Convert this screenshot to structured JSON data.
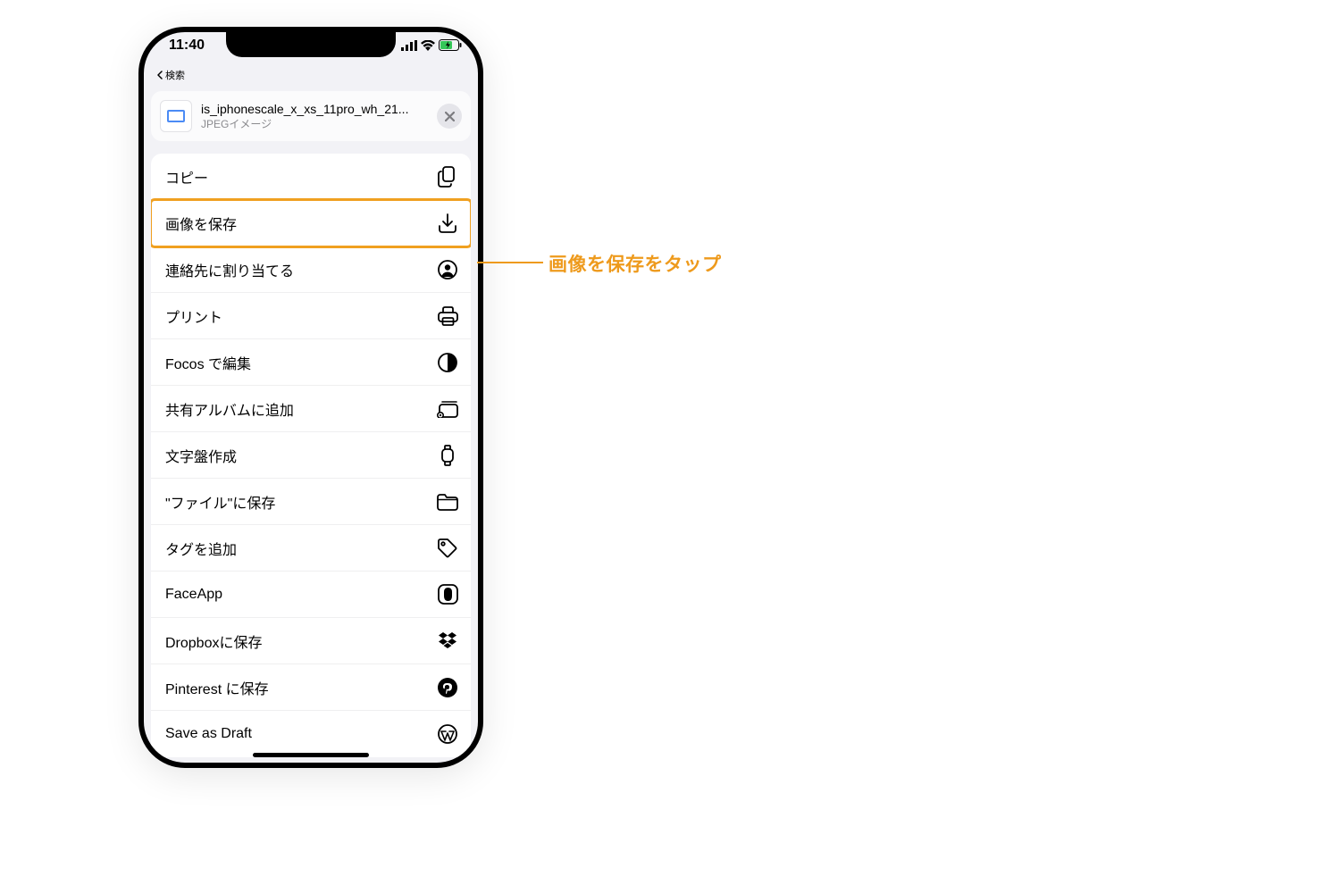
{
  "status": {
    "time": "11:40",
    "back": "検索"
  },
  "share": {
    "filename": "is_iphonescale_x_xs_11pro_wh_21...",
    "filetype": "JPEGイメージ"
  },
  "items": [
    {
      "label": "コピー",
      "icon": "copy"
    },
    {
      "label": "画像を保存",
      "icon": "download",
      "highlight": true
    },
    {
      "label": "連絡先に割り当てる",
      "icon": "contact"
    },
    {
      "label": "プリント",
      "icon": "print"
    },
    {
      "label": "Focos で編集",
      "icon": "halfmoon"
    },
    {
      "label": "共有アルバムに追加",
      "icon": "album"
    },
    {
      "label": "文字盤作成",
      "icon": "watch"
    },
    {
      "label": "\"ファイル\"に保存",
      "icon": "folder"
    },
    {
      "label": "タグを追加",
      "icon": "tag"
    },
    {
      "label": "FaceApp",
      "icon": "faceapp"
    },
    {
      "label": "Dropboxに保存",
      "icon": "dropbox"
    },
    {
      "label": "Pinterest に保存",
      "icon": "pinterest"
    },
    {
      "label": "Save as Draft",
      "icon": "wordpress"
    }
  ],
  "callout": "画像を保存をタップ"
}
